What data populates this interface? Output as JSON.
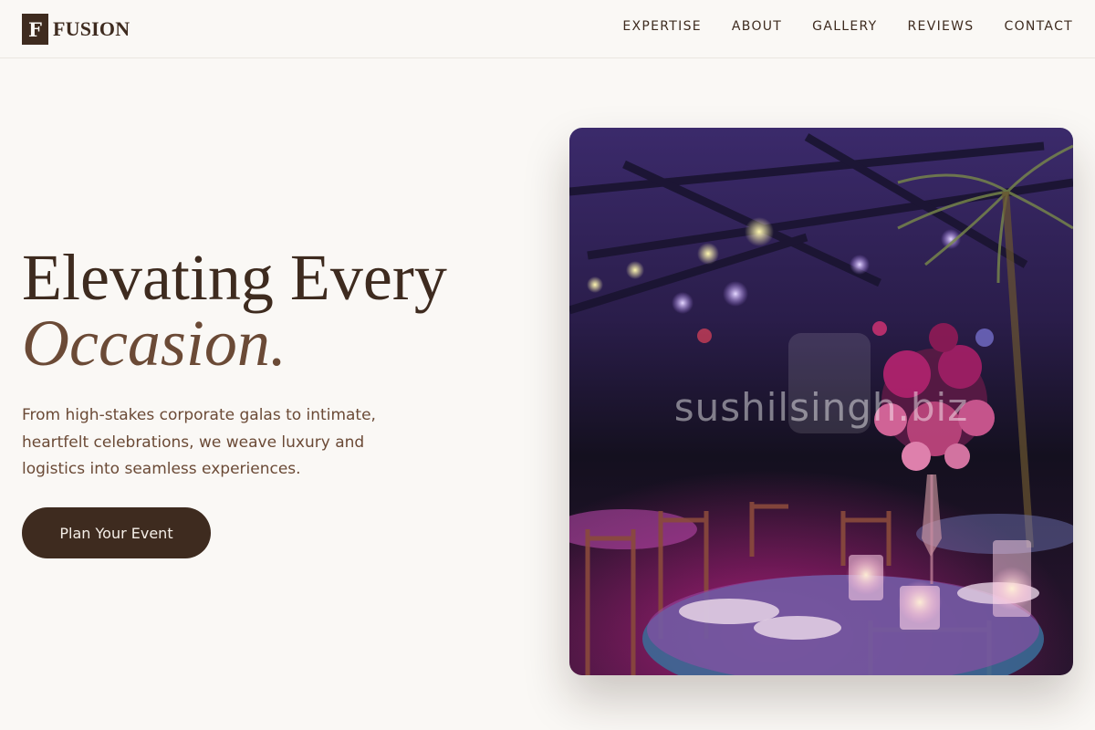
{
  "header": {
    "logo_mark": "F",
    "logo_text": "FUSION",
    "nav": [
      "EXPERTISE",
      "ABOUT",
      "GALLERY",
      "REVIEWS",
      "CONTACT"
    ]
  },
  "hero": {
    "headline_line1": "Elevating Every",
    "headline_line2": "Occasion.",
    "subtext": "From high-stakes corporate galas to intimate, heartfelt celebrations, we weave luxury and logistics into seamless experiences.",
    "cta_label": "Plan Your Event",
    "image_watermark": "sushilsingh.biz"
  },
  "colors": {
    "background": "#faf8f5",
    "primary_brown": "#3e2b1f",
    "accent_brown": "#6b4a36"
  }
}
